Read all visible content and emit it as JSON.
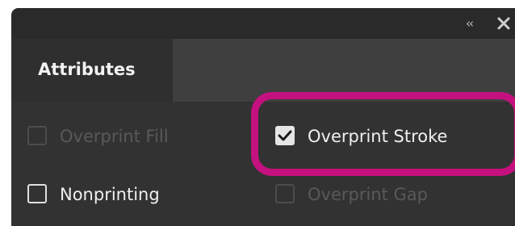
{
  "panel": {
    "collapse_glyph": "‹‹",
    "close_icon": "close-icon",
    "active_tab": "Attributes"
  },
  "options": [
    {
      "label": "Overprint Fill",
      "checked": false,
      "enabled": false
    },
    {
      "label": "Overprint Stroke",
      "checked": true,
      "enabled": true
    },
    {
      "label": "Nonprinting",
      "checked": false,
      "enabled": true
    },
    {
      "label": "Overprint Gap",
      "checked": false,
      "enabled": false
    }
  ],
  "colors": {
    "panel_bg": "#323232",
    "titlebar_bg": "#2a2a2a",
    "tabstrip_bg": "#3f3f3f",
    "annotation_ring": "#c4117f"
  }
}
